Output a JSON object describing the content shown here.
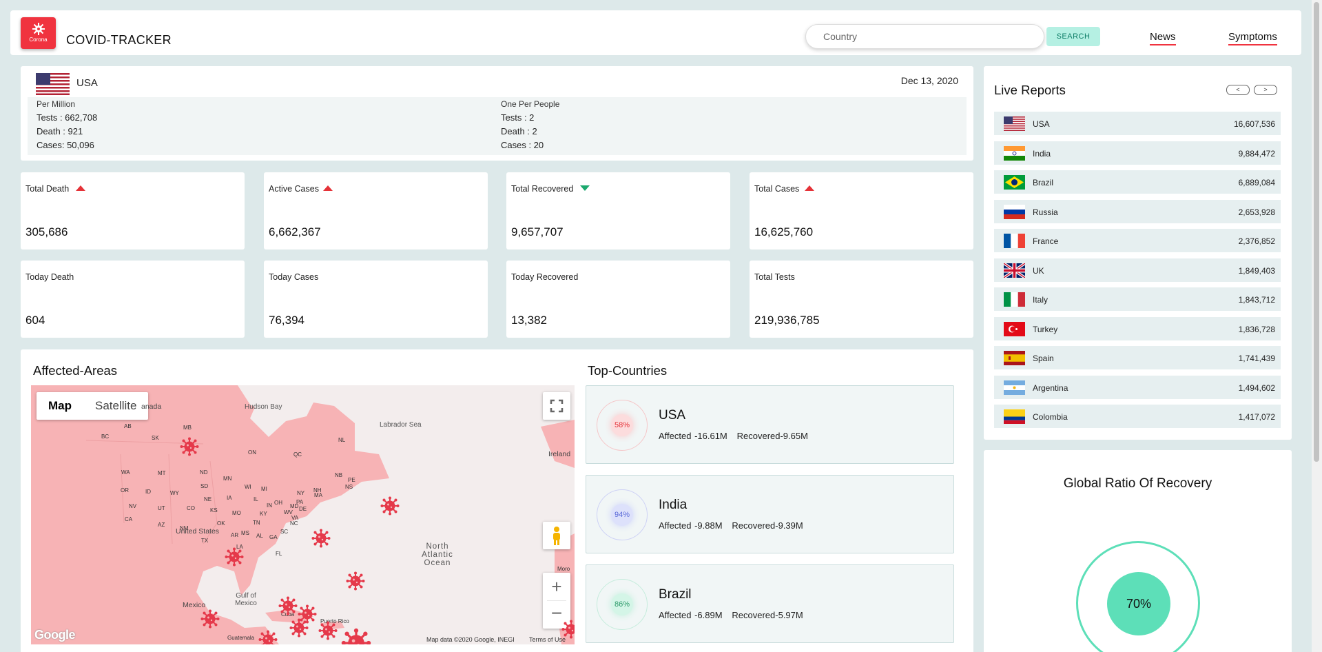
{
  "header": {
    "logo_text": "Corona",
    "app_title": "COVID-TRACKER",
    "search_placeholder": "Country",
    "search_button": "SEARCH",
    "nav": [
      "News",
      "Symptoms"
    ]
  },
  "country_info": {
    "name": "USA",
    "date": "Dec 13, 2020",
    "per_million": {
      "heading": "Per Million",
      "tests": "Tests   : 662,708",
      "death": "Death : 921",
      "cases": "Cases: 50,096"
    },
    "one_per_people": {
      "heading": "One Per People",
      "tests": "Tests    : 2",
      "death": "Death : 2",
      "cases": "Cases : 20"
    }
  },
  "stats": [
    {
      "label": "Total Death",
      "value": "305,686",
      "trend": "up"
    },
    {
      "label": "Active Cases",
      "value": "6,662,367",
      "trend": "up"
    },
    {
      "label": "Total Recovered",
      "value": "9,657,707",
      "trend": "down"
    },
    {
      "label": "Total Cases",
      "value": "16,625,760",
      "trend": "up"
    },
    {
      "label": "Today Death",
      "value": "604"
    },
    {
      "label": "Today Cases",
      "value": "76,394"
    },
    {
      "label": "Today Recovered",
      "value": "13,382"
    },
    {
      "label": "Total Tests",
      "value": "219,936,785"
    }
  ],
  "affected_areas": {
    "title": "Affected-Areas",
    "map_type_options": [
      "Map",
      "Satellite"
    ],
    "selected_map_type": "Map",
    "labels": {
      "canada": "anada",
      "hudson_bay": "Hudson Bay",
      "labrador_sea": "Labrador Sea",
      "ireland": "Ireland",
      "united_states": "United States",
      "north_atlantic": "North Atlantic Ocean",
      "gulf_of_mexico": "Gulf of Mexico",
      "mexico": "Mexico",
      "cuba": "Cuba",
      "puerto_rico": "Puerto Rico",
      "guatemala": "Guatemala",
      "morocco": "Moro"
    },
    "state_labels": [
      "AB",
      "SK",
      "MB",
      "BC",
      "ON",
      "QC",
      "NL",
      "NB",
      "PE",
      "NS",
      "WA",
      "MT",
      "ND",
      "MN",
      "WI",
      "MI",
      "NY",
      "OR",
      "ID",
      "SD",
      "WY",
      "NE",
      "IA",
      "IL",
      "IN",
      "OH",
      "PA",
      "NV",
      "UT",
      "CO",
      "KS",
      "MO",
      "KY",
      "WV",
      "VA",
      "MD",
      "DE",
      "NH",
      "MA",
      "CA",
      "AZ",
      "NM",
      "OK",
      "AR",
      "TN",
      "NC",
      "SC",
      "MS",
      "AL",
      "GA",
      "TX",
      "LA",
      "FL"
    ],
    "footer_data": "Map data ©2020 Google, INEGI",
    "footer_terms": "Terms of Use",
    "google_logo": "Google"
  },
  "top_countries": {
    "title": "Top-Countries",
    "items": [
      {
        "name": "USA",
        "percent": "58%",
        "affected": "Affected -16.61M",
        "recovered": "Recovered-9.65M",
        "color": "#e53238"
      },
      {
        "name": "India",
        "percent": "94%",
        "affected": "Affected -9.88M",
        "recovered": "Recovered-9.39M",
        "color": "#5a6ad8"
      },
      {
        "name": "Brazil",
        "percent": "86%",
        "affected": "Affected -6.89M",
        "recovered": "Recovered-5.97M",
        "color": "#2d9a6a"
      }
    ]
  },
  "live_reports": {
    "title": "Live Reports",
    "prev": "<",
    "next": ">",
    "rows": [
      {
        "country": "USA",
        "count": "16,607,536",
        "flag": "usa-flag"
      },
      {
        "country": "India",
        "count": "9,884,472",
        "flag": "india-flag"
      },
      {
        "country": "Brazil",
        "count": "6,889,084",
        "flag": "brazil-flag"
      },
      {
        "country": "Russia",
        "count": "2,653,928",
        "flag": "russia-flag"
      },
      {
        "country": "France",
        "count": "2,376,852",
        "flag": "france-flag"
      },
      {
        "country": "UK",
        "count": "1,849,403",
        "flag": "uk-flag"
      },
      {
        "country": "Italy",
        "count": "1,843,712",
        "flag": "italy-flag"
      },
      {
        "country": "Turkey",
        "count": "1,836,728",
        "flag": "turkey-flag"
      },
      {
        "country": "Spain",
        "count": "1,741,439",
        "flag": "spain-flag"
      },
      {
        "country": "Argentina",
        "count": "1,494,602",
        "flag": "argentina-flag"
      },
      {
        "country": "Colombia",
        "count": "1,417,072",
        "flag": "colombia-flag"
      }
    ]
  },
  "recovery_ratio": {
    "title": "Global Ratio Of Recovery",
    "value": "70%",
    "color": "#5ddfb8"
  },
  "colors": {
    "accent": "#f0333f",
    "teal": "#5ddfb8",
    "background": "#dde9ea"
  }
}
